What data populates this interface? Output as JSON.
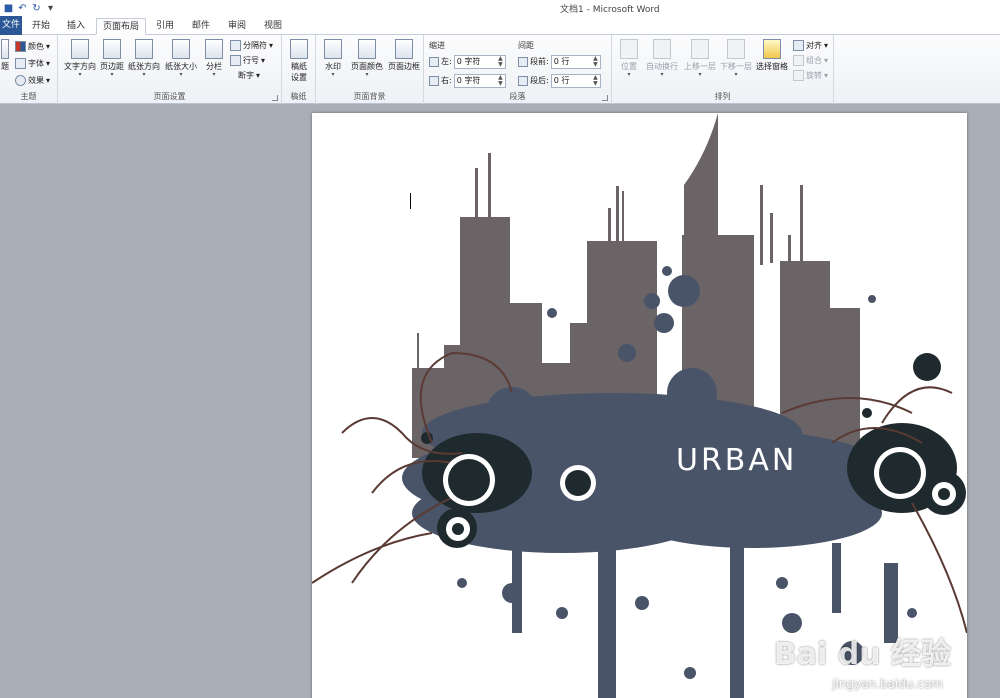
{
  "window": {
    "title": "文档1 - Microsoft Word"
  },
  "tabs": [
    {
      "label": "文件"
    },
    {
      "label": "开始"
    },
    {
      "label": "插入"
    },
    {
      "label": "页面布局"
    },
    {
      "label": "引用"
    },
    {
      "label": "邮件"
    },
    {
      "label": "审阅"
    },
    {
      "label": "视图"
    }
  ],
  "ribbon": {
    "theme": {
      "label": "主题",
      "big": "题",
      "colors": "颜色",
      "fonts": "字体",
      "effects": "效果"
    },
    "page_setup": {
      "label": "页面设置",
      "text_direction": "文字方向",
      "margins": "页边距",
      "orientation": "纸张方向",
      "size": "纸张大小",
      "columns": "分栏",
      "breaks": "分隔符",
      "line_numbers": "行号",
      "hyphenation": "断字"
    },
    "draft": {
      "label": "稿纸",
      "settings": "稿纸\n设置",
      "settings_a": "稿纸",
      "settings_b": "设置"
    },
    "background": {
      "label": "页面背景",
      "watermark": "水印",
      "page_color": "页面颜色",
      "page_borders": "页面边框"
    },
    "paragraph": {
      "label": "段落",
      "indent": "缩进",
      "spacing": "间距",
      "left": "左:",
      "right": "右:",
      "before": "段前:",
      "after": "段后:",
      "left_value": "0 字符",
      "right_value": "0 字符",
      "before_value": "0 行",
      "after_value": "0 行"
    },
    "arrange": {
      "label": "排列",
      "position": "位置",
      "wrap": "自动换行",
      "forward": "上移一层",
      "backward": "下移一层",
      "selection_pane": "选择窗格",
      "align": "对齐",
      "group": "组合",
      "rotate": "旋转"
    }
  },
  "document": {
    "artwork_text": "URBAN",
    "watermark": "Bai du 经验",
    "watermark_url": "jingyan.baidu.com"
  },
  "colors": {
    "ribbon_accent": "#2b5797",
    "building": "#6b6466",
    "splash": "#4a5468",
    "dark_circle": "#1f2a2e",
    "swirl": "#5a3a33"
  }
}
